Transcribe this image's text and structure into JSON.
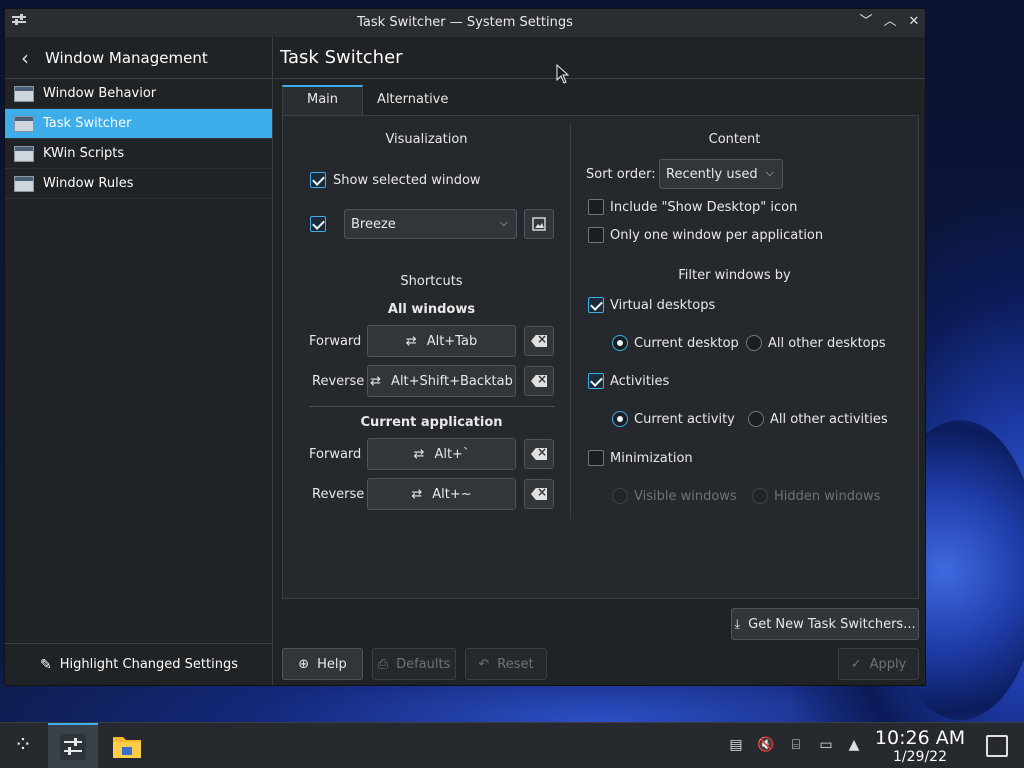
{
  "window": {
    "title": "Task Switcher — System Settings",
    "controls": {
      "minimize": "﹀",
      "maximize": "︿",
      "close": "✕"
    }
  },
  "sidebar": {
    "header": "Window Management",
    "items": [
      {
        "label": "Window Behavior",
        "icon": "window-icon",
        "active": false
      },
      {
        "label": "Task Switcher",
        "icon": "window-icon",
        "active": true
      },
      {
        "label": "KWin Scripts",
        "icon": "script-icon",
        "active": false
      },
      {
        "label": "Window Rules",
        "icon": "window-icon",
        "active": false
      }
    ],
    "footer": "Highlight Changed Settings"
  },
  "main": {
    "title": "Task Switcher",
    "tabs": [
      "Main",
      "Alternative"
    ],
    "visualization": {
      "header": "Visualization",
      "show_selected_window": {
        "label": "Show selected window",
        "checked": true
      },
      "theme_enabled": true,
      "theme": "Breeze"
    },
    "shortcuts": {
      "header": "Shortcuts",
      "all_windows": "All windows",
      "current_application": "Current application",
      "forward_label": "Forward",
      "reverse_label": "Reverse",
      "all_forward": "Alt+Tab",
      "all_reverse": "Alt+Shift+Backtab",
      "app_forward": "Alt+`",
      "app_reverse": "Alt+~"
    },
    "content": {
      "header": "Content",
      "sort_label": "Sort order:",
      "sort_value": "Recently used",
      "show_desktop": {
        "label": "Include \"Show Desktop\" icon",
        "checked": false
      },
      "one_per_app": {
        "label": "Only one window per application",
        "checked": false
      },
      "filter_header": "Filter windows by",
      "virtual_desktops": {
        "label": "Virtual desktops",
        "checked": true
      },
      "current_desktop": "Current desktop",
      "all_other_desktops": "All other desktops",
      "activities": {
        "label": "Activities",
        "checked": true
      },
      "current_activity": "Current activity",
      "all_other_activities": "All other activities",
      "minimization": {
        "label": "Minimization",
        "checked": false
      },
      "visible_windows": "Visible windows",
      "hidden_windows": "Hidden windows"
    },
    "get_new": "Get New Task Switchers...",
    "footer": {
      "help": "Help",
      "defaults": "Defaults",
      "reset": "Reset",
      "apply": "Apply"
    }
  },
  "taskbar": {
    "time": "10:26 AM",
    "date": "1/29/22"
  },
  "colors": {
    "accent": "#3daee9",
    "window_bg": "#202326",
    "panel_bg": "#25292d"
  }
}
